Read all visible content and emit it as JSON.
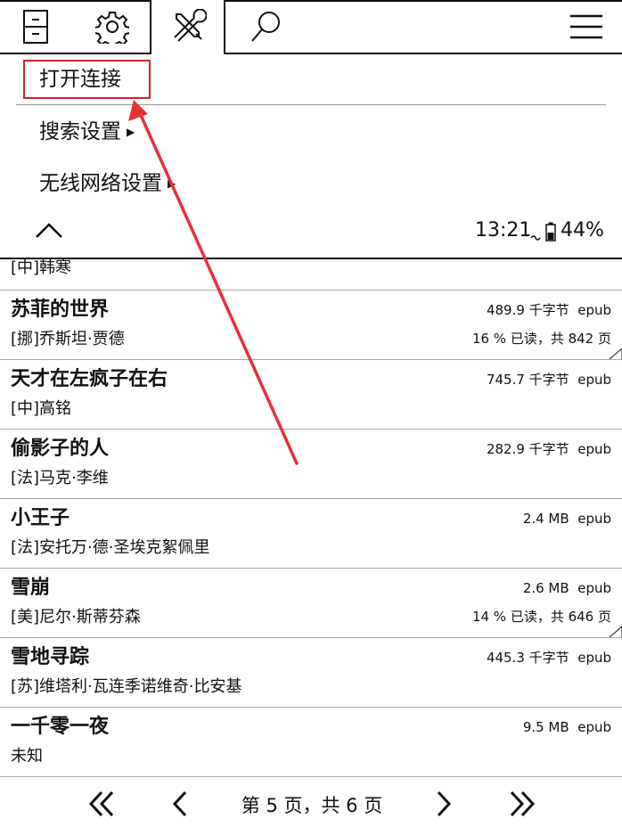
{
  "tabs": [
    {
      "icon": "device-icon"
    },
    {
      "icon": "gear-icon"
    },
    {
      "icon": "tools-icon",
      "active": true
    },
    {
      "icon": "search-icon"
    },
    {
      "icon": "hamburger-menu-icon"
    }
  ],
  "menu": {
    "items": [
      {
        "label": "打开连接"
      },
      {
        "label": "搜索设置",
        "submenu_arrow": "▶"
      },
      {
        "label": "无线网络设置",
        "submenu_arrow": "▶"
      }
    ],
    "highlight_color": "#d3232d",
    "annotation_arrow_color": "#e8303a"
  },
  "status": {
    "collapse_icon": "chevron-up-icon",
    "time": "13:21",
    "battery": "44%"
  },
  "books": [
    {
      "title": "",
      "author": "[中]韩寒",
      "size": "",
      "format": "",
      "progress": ""
    },
    {
      "title": "苏菲的世界",
      "author": "[挪]乔斯坦·贾德",
      "size": "489.9 千字节",
      "format": "epub",
      "progress": "16 % 已读，共 842 页"
    },
    {
      "title": "天才在左疯子在右",
      "author": "[中]高铭",
      "size": "745.7 千字节",
      "format": "epub",
      "progress": ""
    },
    {
      "title": "偷影子的人",
      "author": "[法]马克·李维",
      "size": "282.9 千字节",
      "format": "epub",
      "progress": ""
    },
    {
      "title": "小王子",
      "author": "[法]安托万·德·圣埃克絮佩里",
      "size": "2.4 MB",
      "format": "epub",
      "progress": ""
    },
    {
      "title": "雪崩",
      "author": "[美]尼尔·斯蒂芬森",
      "size": "2.6 MB",
      "format": "epub",
      "progress": "14 % 已读，共 646 页"
    },
    {
      "title": "雪地寻踪",
      "author": "[苏]维塔利·瓦连季诺维奇·比安基",
      "size": "445.3 千字节",
      "format": "epub",
      "progress": ""
    },
    {
      "title": "一千零一夜",
      "author": "未知",
      "size": "9.5 MB",
      "format": "epub",
      "progress": ""
    }
  ],
  "pager": {
    "label": "第 5 页，共 6 页",
    "first": "«",
    "prev": "‹",
    "next": "›",
    "last": "»"
  }
}
